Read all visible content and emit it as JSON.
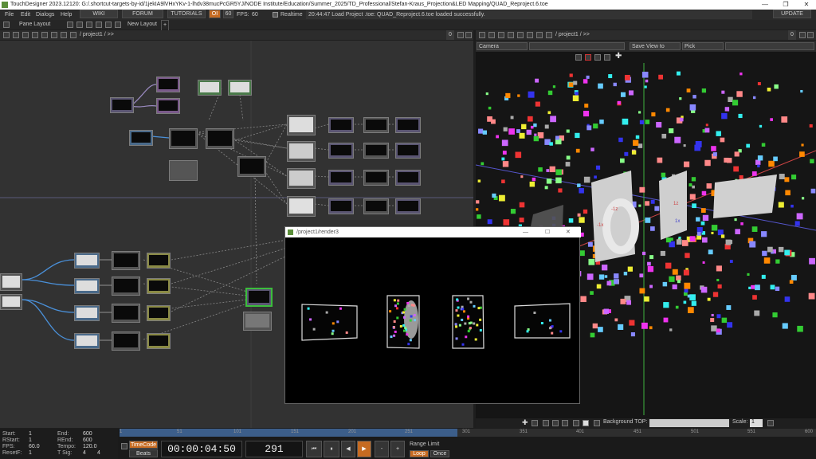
{
  "window": {
    "title": "TouchDesigner 2023.12120: G:/.shortcut-targets-by-id/1jekIA9lVHxYKv-1-lhdv38mucPcGR5YJ/NODE Institute/Education/Summer_2025/TD_Professional/Stefan-Kraus_Projection&LED Mapping/QUAD_Reproject.6.toe",
    "minimize": "—",
    "maximize": "❐",
    "close": "✕"
  },
  "menu": {
    "items": [
      "File",
      "Edit",
      "Dialogs",
      "Help"
    ],
    "wiki": "WIKI",
    "forum": "FORUM",
    "tutorials": "TUTORIALS",
    "oi_badge": "OI",
    "bars_badge": "60",
    "fps_label": "FPS:",
    "fps_value": "60",
    "realtime": "Realtime",
    "status": "20:44:47 Load Project .toe: QUAD_Reproject.6.toe loaded successfully.",
    "update": "UPDATE"
  },
  "toolbar": {
    "pane_layout": "Pane Layout",
    "new_layout": "New Layout",
    "plus": "+"
  },
  "left_pane": {
    "path": "/ project1 / >>",
    "badge_num": "0"
  },
  "right_pane": {
    "path": "/ project1 / >>",
    "badge_num": "0",
    "camera_select": "Camera",
    "save_view": "Save View to",
    "pick": "Pick",
    "background_top_label": "Background TOP:",
    "scale_label": "Scale:",
    "scale_value": "1"
  },
  "floating_window": {
    "title": "/project1/render3",
    "minimize": "—",
    "maximize": "☐",
    "close": "✕"
  },
  "timeline": {
    "start_label": "Start:",
    "start": "1",
    "end_label": "End:",
    "end": "600",
    "rstart_label": "RStart:",
    "rstart": "1",
    "rend_label": "REnd:",
    "rend": "600",
    "fps_label": "FPS:",
    "fps": "60.0",
    "tempo_label": "Tempo:",
    "tempo": "120.0",
    "resetf_label": "ResetF:",
    "resetf": "1",
    "tsig_label": "T Sig:",
    "tsig_a": "4",
    "tsig_b": "4",
    "timecode_btn": "TimeCode",
    "beats_btn": "Beats",
    "timecode": "00:00:04:50",
    "frame": "291",
    "range_limit": "Range Limit",
    "loop": "Loop",
    "once": "Once",
    "ruler_ticks": [
      "1",
      "51",
      "101",
      "151",
      "201",
      "251",
      "301",
      "351",
      "401",
      "451",
      "501",
      "551",
      "600"
    ],
    "progress_fraction": 0.485
  },
  "viewport_labels": {
    "x_a": "-1z",
    "x_b": "-1x",
    "x_c": "1z",
    "x_d": "1x"
  }
}
